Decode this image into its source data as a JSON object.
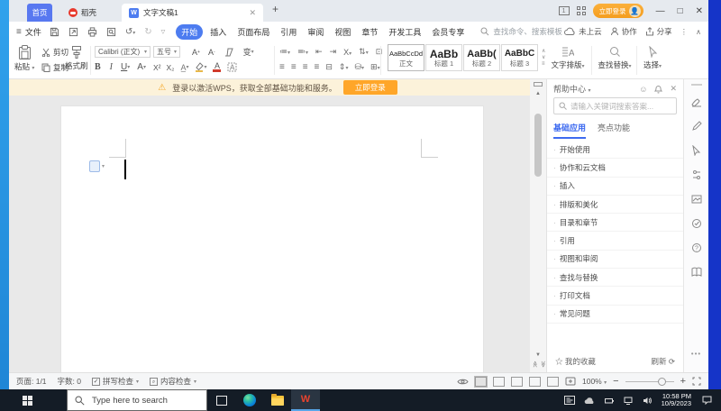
{
  "icons": {
    "close": "✕",
    "plus": "+",
    "minimize": "—",
    "maximize": "□",
    "wps_w": "W",
    "menu_bars": "≡",
    "caret": "▾",
    "warning": "⚠",
    "undo": "↺",
    "redo": "↻",
    "more_v": "⋮",
    "collapse": "∧",
    "star": "☆",
    "refresh": "⟳",
    "smiley": "☺",
    "up": "▲",
    "down": "▼",
    "chevrons": "≪"
  },
  "tabs": {
    "home": "首页",
    "docer": "稻壳",
    "document": "文字文稿1"
  },
  "titlebar": {
    "login_button": "立即登录",
    "onewin": "1"
  },
  "menu": {
    "file": "文件",
    "items": [
      "开始",
      "插入",
      "页面布局",
      "引用",
      "审阅",
      "视图",
      "章节",
      "开发工具",
      "会员专享"
    ],
    "search_placeholder": "查找命令、搜索模板",
    "cloud": "未上云",
    "collab": "协作",
    "share": "分享"
  },
  "ribbon": {
    "paste": "粘贴",
    "cut": "剪切",
    "copy": "复制",
    "format_painter": "格式刷",
    "font_name": "Calibri (正文)",
    "font_size": "五号",
    "bold": "B",
    "italic": "I",
    "underline": "U",
    "sup": "X²",
    "sub": "X₂",
    "pinyin": "变",
    "styles": [
      {
        "sample": "AaBbCcDd",
        "label": "正文"
      },
      {
        "sample": "AaBb",
        "label": "标题 1"
      },
      {
        "sample": "AaBb(",
        "label": "标题 2"
      },
      {
        "sample": "AaBbC",
        "label": "标题 3"
      }
    ],
    "text_tool": "文字排版",
    "find_replace": "查找替换",
    "select": "选择"
  },
  "notification": {
    "text": "登录以激活WPS，获取全部基础功能和服务。",
    "button": "立即登录"
  },
  "help": {
    "title": "帮助中心",
    "search_placeholder": "请输入关键词搜索答案...",
    "tab_basic": "基础应用",
    "tab_highlight": "亮点功能",
    "items": [
      "开始使用",
      "协作和云文档",
      "插入",
      "排版和美化",
      "目录和章节",
      "引用",
      "视图和审阅",
      "查找与替换",
      "打印文档",
      "常见问题"
    ],
    "favorites": "我的收藏",
    "refresh": "刷新"
  },
  "status": {
    "page": "页面: 1/1",
    "words": "字数: 0",
    "spell": "拼写检查",
    "content_check": "内容检查",
    "zoom": "100%"
  },
  "taskbar": {
    "search_placeholder": "Type here to search",
    "time": "10:58 PM",
    "date": "10/9/2023"
  }
}
